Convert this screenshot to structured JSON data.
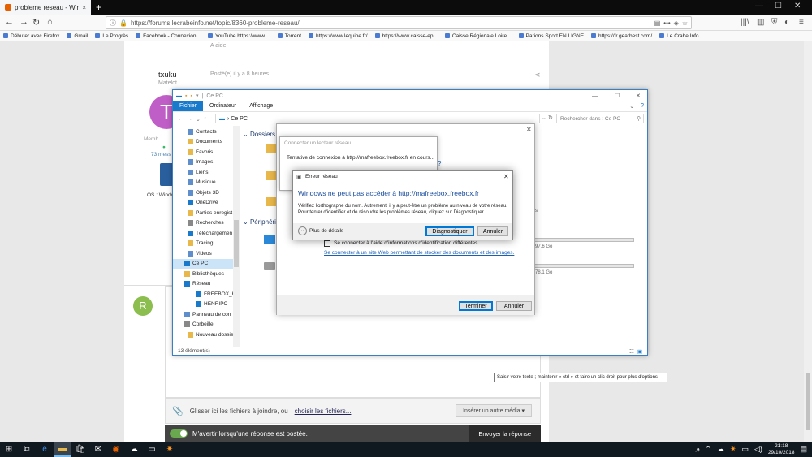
{
  "browser": {
    "tab_title": "probleme reseau - Windows - ",
    "tab_close": "×",
    "new_tab": "+",
    "url": "https://forums.lecrabeinfo.net/topic/8360-probleme-reseau/",
    "url_actions": "•••",
    "bookmarks": [
      "Débuter avec Firefox",
      "Gmail",
      "Le Progrès",
      "Facebook - Connexion...",
      "YouTube https://www....",
      "Torrent",
      "https://www.lequipe.fr/",
      "https://www.caisse-ep...",
      "Caisse Régionale Loire...",
      "Parions Sport EN LIGNE",
      "https://fr.gearbest.com/",
      "Le Crabe Info"
    ]
  },
  "forum": {
    "answer_label": "A aide",
    "post_author": "txuku",
    "post_rank": "Matelot",
    "post_time": "Posté(e) il y a 8 heures",
    "avatar_letter": "T",
    "member_label": "Memb",
    "messages_label": "73 mess",
    "os_label": "OS : Windo",
    "reply_avatar_letter": "R",
    "attach_text": "Glisser ici les fichiers à joindre, ou",
    "attach_link": "choisir les fichiers...",
    "insert_media": "Insérer un autre média",
    "notify_label": "M'avertir lorsqu'une réponse est postée.",
    "send_button": "Envoyer la réponse",
    "tooltip": "Saisir votre texte ; maintenir « ctrl » et faire un clic droit pour plus d'options"
  },
  "explorer": {
    "title": "Ce PC",
    "ribbon": [
      "Fichier",
      "Ordinateur",
      "Affichage"
    ],
    "path": "Ce PC",
    "search_placeholder": "Rechercher dans : Ce PC",
    "nav_items": [
      "Contacts",
      "Documents",
      "Favoris",
      "Images",
      "Liens",
      "Musique",
      "Objets 3D",
      "OneDrive",
      "Parties enregist",
      "Recherches",
      "Téléchargemen",
      "Tracing",
      "Vidéos",
      "Ce PC",
      "Bibliothèques",
      "Réseau",
      "FREEBOX_HEN",
      "HENRIPC",
      "Panneau de con",
      "Corbeille",
      "Nouveau dossie"
    ],
    "section_folders": "Dossiers (",
    "section_devices": "Périphérie",
    "drive1_free": "97,6 Go",
    "drive2_free": "78,1 Go",
    "status": "13 élément(s)"
  },
  "map_drive_dialog": {
    "checkbox_label": "Se connecter à l'aide d'informations d'identification différentes",
    "link": "Se connecter à un site Web permettant de stocker des documents et des images.",
    "finish_button": "Terminer",
    "cancel_button": "Annuler",
    "question_mark": "?"
  },
  "progress_dialog": {
    "title": "Connecter un lecteur réseau",
    "message": "Tentative de connexion à http://mafreebox.freebox.fr en cours..."
  },
  "error_dialog": {
    "title": "Erreur réseau",
    "heading": "Windows ne peut pas accéder à http://mafreebox.freebox.fr",
    "body": "Vérifiez l'orthographe du nom. Autrement, il y a peut-être un problème au niveau de votre réseau. Pour tenter d'identifier et de résoudre les problèmes réseau, cliquez sur Diagnostiquer.",
    "details": "Plus de détails",
    "diagnose_button": "Diagnostiquer",
    "cancel_button": "Annuler"
  },
  "taskbar": {
    "time": "21:18",
    "date": "29/10/2018"
  },
  "colors": {
    "accent": "#1979ca",
    "link": "#1a5fb4",
    "avatar": "#c05ec7",
    "reply_avatar": "#8bbd4f",
    "taskbar": "#101820"
  }
}
